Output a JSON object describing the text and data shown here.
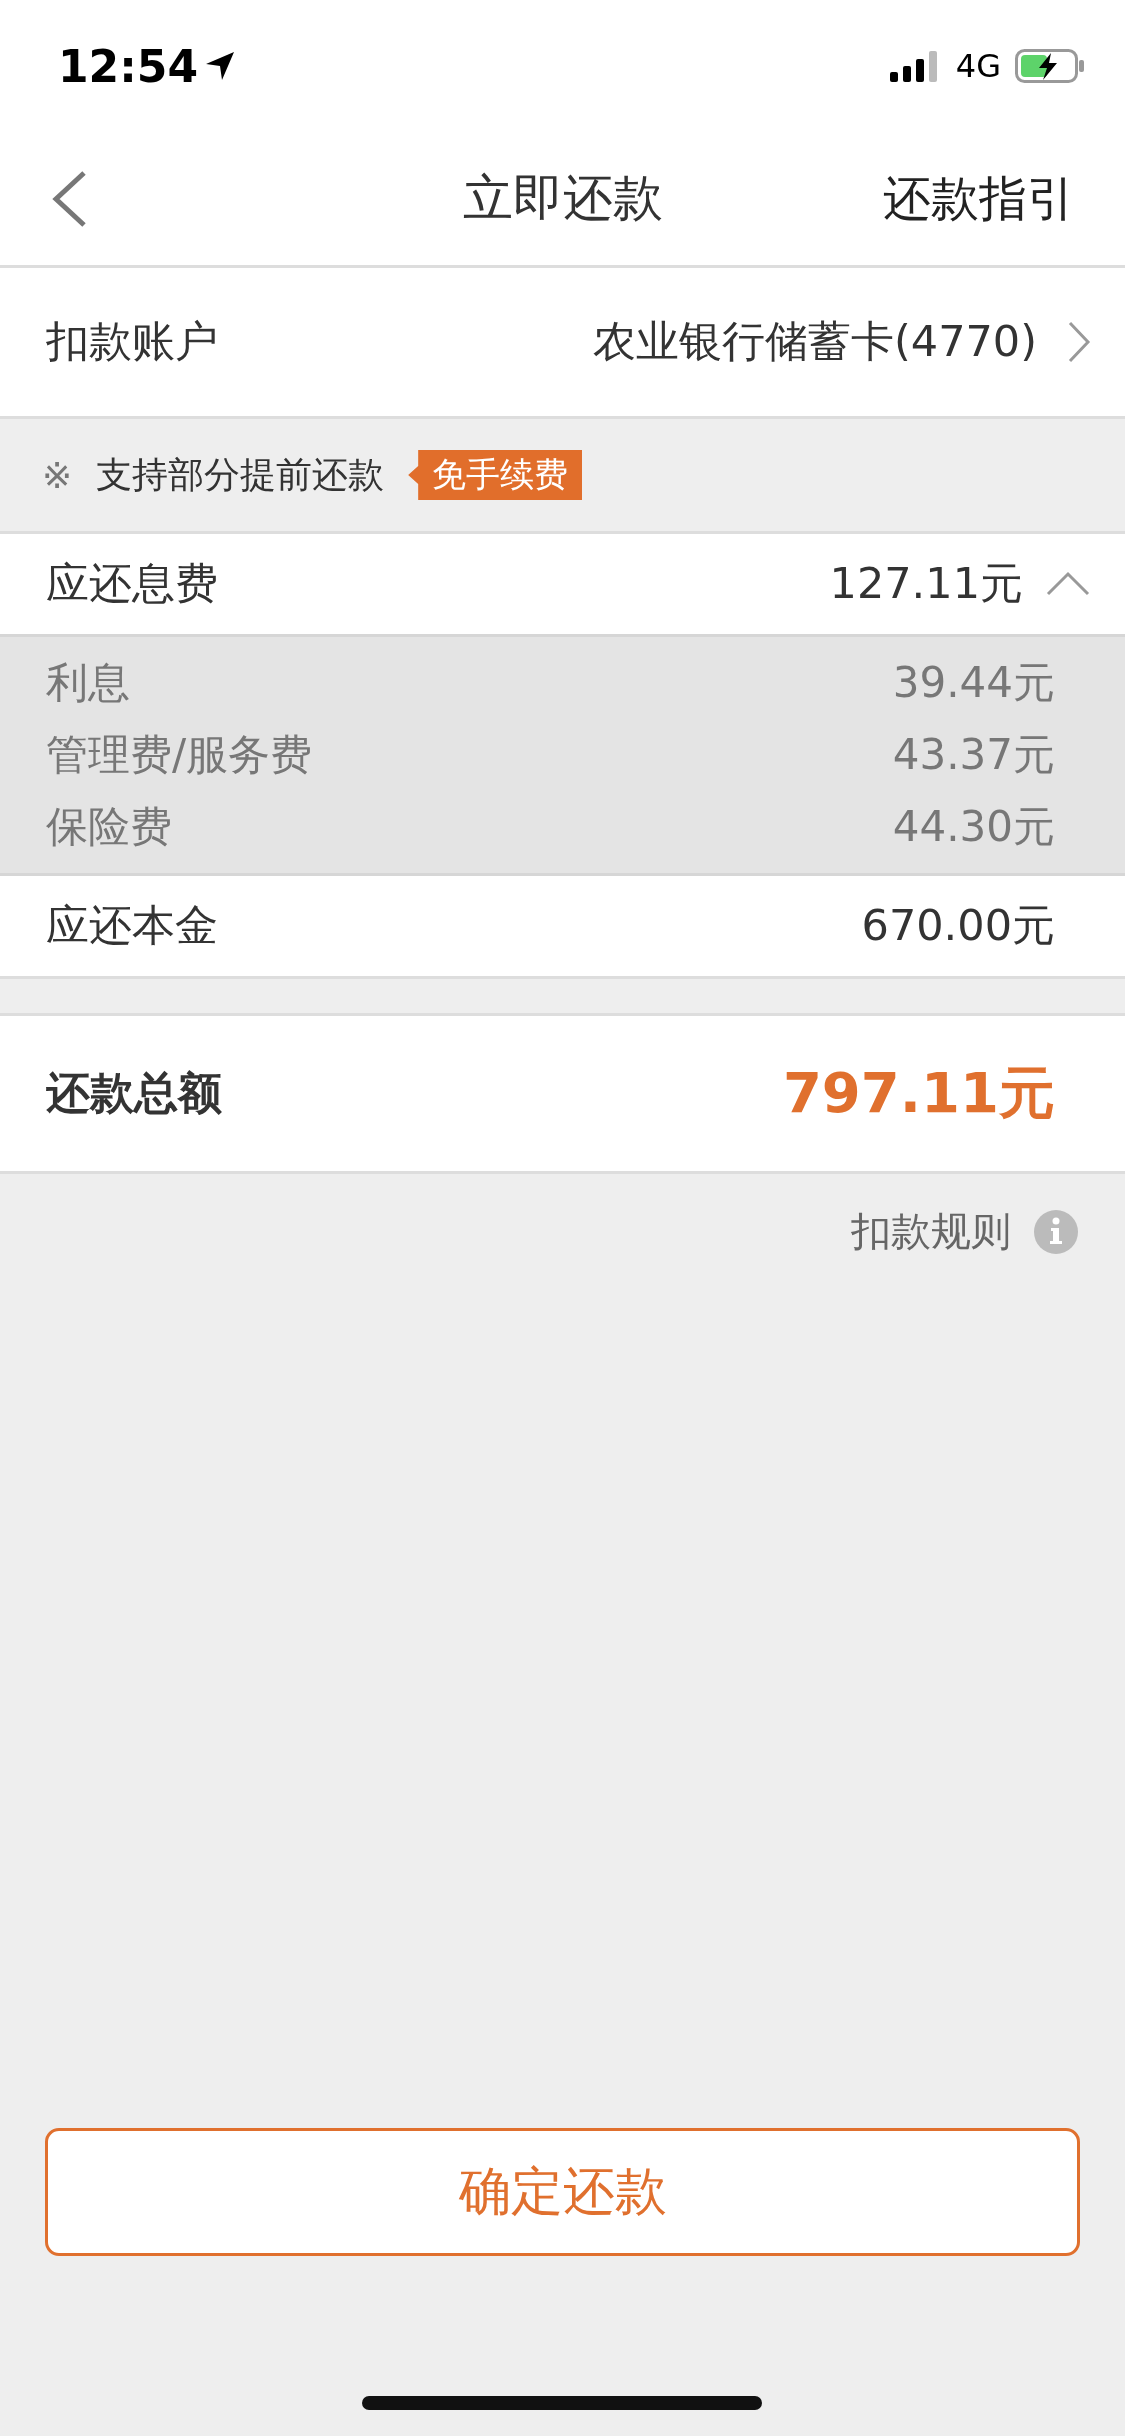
{
  "status_bar": {
    "time": "12:54",
    "network": "4G"
  },
  "nav": {
    "title": "立即还款",
    "action": "还款指引"
  },
  "account": {
    "label": "扣款账户",
    "value": "农业银行储蓄卡(4770)"
  },
  "notice": {
    "mark": "※",
    "text": "支持部分提前还款",
    "badge": "免手续费"
  },
  "interest": {
    "label": "应还息费",
    "value": "127.11元",
    "expanded": true,
    "items": [
      {
        "label": "利息",
        "value": "39.44元"
      },
      {
        "label": "管理费/服务费",
        "value": "43.37元"
      },
      {
        "label": "保险费",
        "value": "44.30元"
      }
    ]
  },
  "principal": {
    "label": "应还本金",
    "value": "670.00元"
  },
  "total": {
    "label": "还款总额",
    "value": "797.11元"
  },
  "rules_link": "扣款规则",
  "confirm_button": "确定还款"
}
